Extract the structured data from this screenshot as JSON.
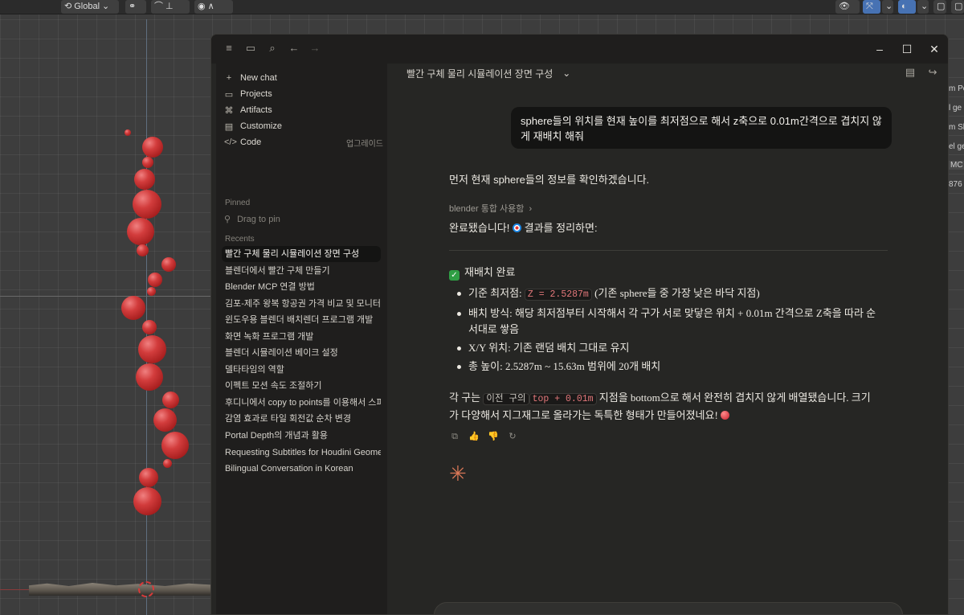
{
  "blender": {
    "toolbar": {
      "transform_orientation": "Global"
    },
    "properties_panel_fragments": [
      "m Po",
      "l ge",
      "m Sk",
      "el ge",
      "MC",
      "876"
    ]
  },
  "app": {
    "sidebar": {
      "nav": [
        {
          "label": "New chat",
          "icon": "plus-icon"
        },
        {
          "label": "Projects",
          "icon": "folder-icon"
        },
        {
          "label": "Artifacts",
          "icon": "artifacts-icon"
        },
        {
          "label": "Customize",
          "icon": "customize-icon"
        },
        {
          "label": "Code",
          "icon": "code-icon",
          "badge": "업그레이드"
        }
      ],
      "pinned_heading": "Pinned",
      "pinned_placeholder": "Drag to pin",
      "recents_heading": "Recents",
      "recents": [
        "빨간 구체 물리 시뮬레이션 장면 구성",
        "블렌더에서 빨간 구체 만들기",
        "Blender MCP 연결 방법",
        "김포-제주 왕복 항공권 가격 비교 및 모니터링",
        "윈도우용 블렌더 배치렌더 프로그램 개발",
        "화면 녹화 프로그램 개발",
        "블렌더 시뮬레이션 베이크 설정",
        "델타타임의 역할",
        "이펙트 모션 속도 조절하기",
        "후디니에서 copy to points를 이용해서 스피어",
        "감염 효과로 타일 회전값 순차 변경",
        "Portal Depth의 개념과 활용",
        "Requesting Subtitles for Houdini Geometry",
        "Bilingual Conversation in Korean"
      ]
    },
    "conversation": {
      "title": "빨간 구체 물리 시뮬레이션 장면 구성",
      "user_message": "sphere들의 위치를 현재 높이를 최저점으로 해서 z축으로 0.01m간격으로 겹치지 않게 재배치 해줘",
      "assistant_intro": "먼저 현재 sphere들의 정보를 확인하겠습니다.",
      "tool_used": "blender 통합 사용함",
      "done_text_before": "완료됐습니다!",
      "done_text_after": "결과를 정리하면:",
      "section_heading": "재배치 완료",
      "bullets": [
        {
          "label": "기준 최저점:",
          "code": "Z = 2.5287m",
          "text": "(기존 sphere들 중 가장 낮은 바닥 지점)"
        },
        {
          "label": "배치 방식:",
          "text": "해당 최저점부터 시작해서 각 구가 서로 맞닿은 위치 + 0.01m 간격으로 Z축을 따라 순서대로 쌓음"
        },
        {
          "label": "X/Y 위치:",
          "text": "기존 랜덤 배치 그대로 유지"
        },
        {
          "label": "총 높이:",
          "text": "2.5287m ~ 15.63m 범위에 20개 배치"
        }
      ],
      "summary_part1": "각 구는",
      "summary_code1": "이전 구의",
      "summary_code2": "top + 0.01m",
      "summary_part2": "지점을 bottom으로 해서 완전히 겹치지 않게 배열됐습니다. 크기가 다양해서 지그재그로 올라가는 독특한 형태가 만들어졌네요!"
    }
  }
}
